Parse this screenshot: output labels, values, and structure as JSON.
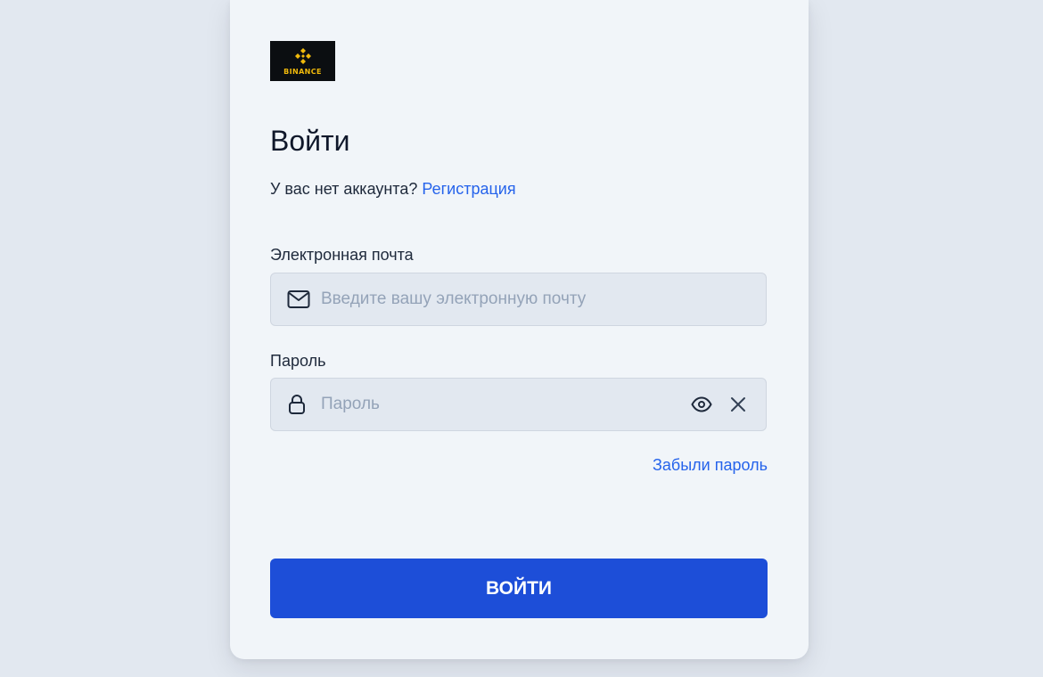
{
  "logo": {
    "text": "BINANCE",
    "icon": "binance-diamond-icon",
    "color": "#f0b90b"
  },
  "title": "Войти",
  "signup_prompt": {
    "text": "У вас нет аккаунта?",
    "link": "Регистрация"
  },
  "email": {
    "label": "Электронная почта",
    "placeholder": "Введите вашу электронную почту",
    "value": "",
    "icon": "mail-icon"
  },
  "password": {
    "label": "Пароль",
    "placeholder": "Пароль",
    "value": "",
    "icon": "lock-icon",
    "toggle_icon": "eye-icon",
    "clear_icon": "close-icon"
  },
  "forgot_password": "Забыли пароль",
  "submit_label": "ВОЙТИ",
  "colors": {
    "accent": "#1d4ed8",
    "link": "#2563eb",
    "background": "#e2e8f0",
    "card": "#f1f5f9"
  }
}
